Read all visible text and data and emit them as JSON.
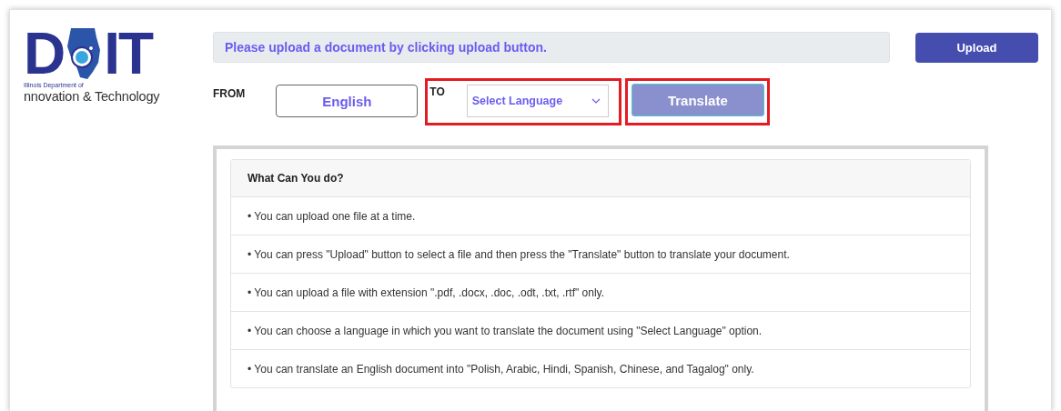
{
  "logo": {
    "left": "D",
    "right": "IT",
    "small": "Illinois Department of",
    "tagline": "nnovation & Technology"
  },
  "status_message": "Please upload a document by clicking upload button.",
  "upload_button": {
    "label": "Upload"
  },
  "from": {
    "label": "FROM",
    "value": "English"
  },
  "to": {
    "label": "TO",
    "value": "Select Language",
    "highlighted": true
  },
  "translate_button": {
    "label": "Translate",
    "disabled": true,
    "highlighted": true
  },
  "info_card": {
    "title": "What Can You do?",
    "items": [
      "• You can upload one file at a time.",
      "• You can press \"Upload\" button to select a file and then press the \"Translate\" button to translate your document.",
      "• You can upload a file with extension \".pdf, .docx, .doc, .odt, .txt, .rtf\" only.",
      "• You can choose a language in which you want to translate the document using \"Select Language\" option.",
      "• You can translate an English document into \"Polish, Arabic, Hindi, Spanish, Chinese, and Tagalog\" only."
    ]
  }
}
